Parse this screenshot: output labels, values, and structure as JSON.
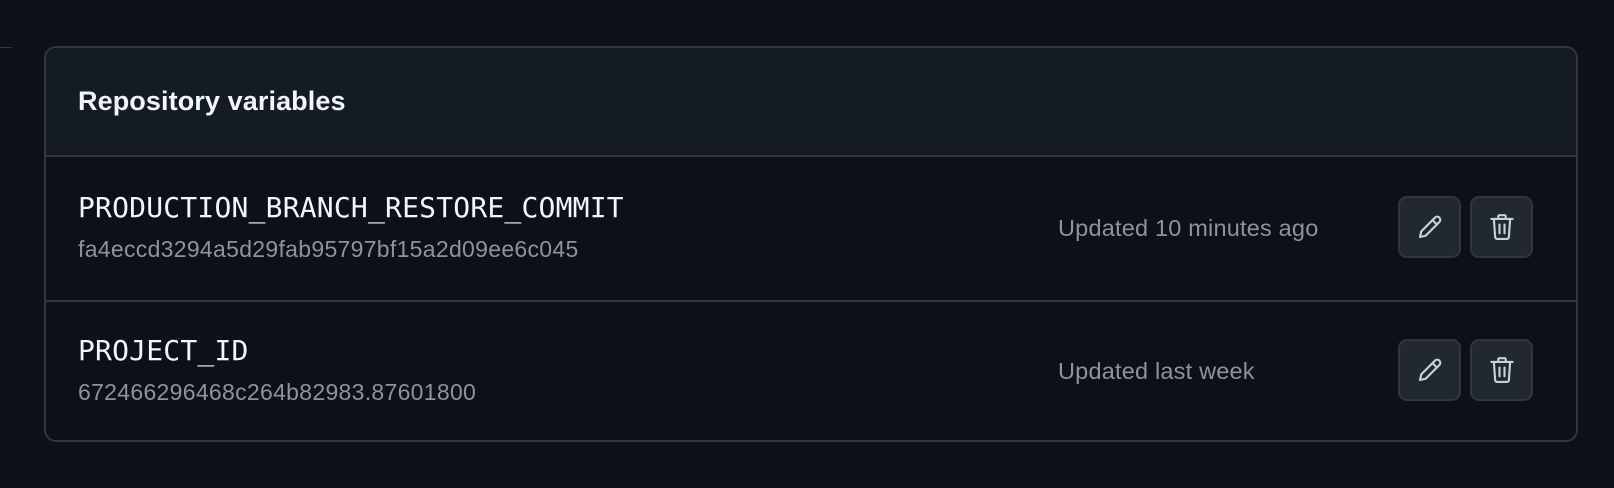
{
  "panel": {
    "title": "Repository variables"
  },
  "variables": [
    {
      "name": "PRODUCTION_BRANCH_RESTORE_COMMIT",
      "value": "fa4eccd3294a5d29fab95797bf15a2d09ee6c045",
      "updated": "Updated 10 minutes ago",
      "edit_icon": "pencil-icon",
      "delete_icon": "trash-icon"
    },
    {
      "name": "PROJECT_ID",
      "value": "672466296468c264b82983.87601800",
      "updated": "Updated last week",
      "edit_icon": "pencil-icon",
      "delete_icon": "trash-icon"
    }
  ],
  "colors": {
    "background": "#0d1117",
    "header_background": "#151b23",
    "border": "#30363d",
    "text_primary": "#f0f6fc",
    "text_muted": "#8b949e",
    "button_background": "#212830"
  }
}
